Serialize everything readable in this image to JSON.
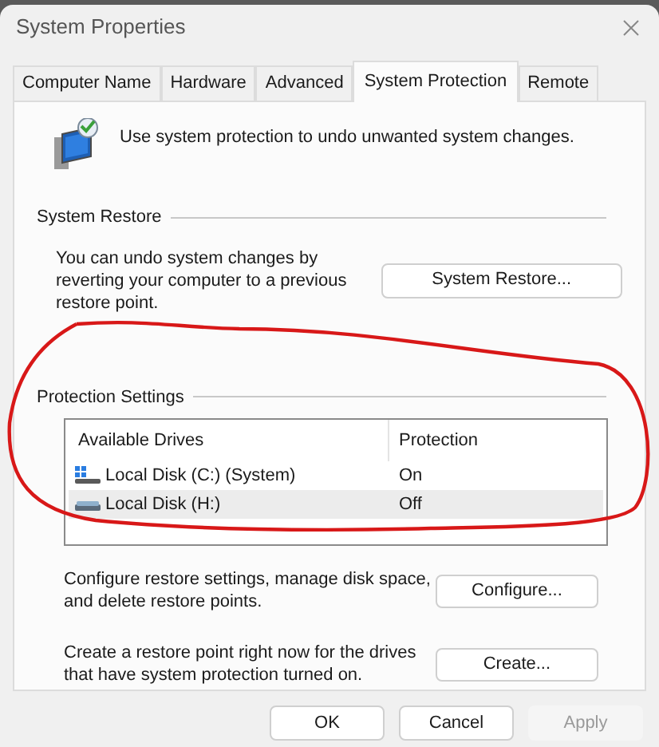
{
  "window": {
    "title": "System Properties"
  },
  "tabs": [
    {
      "label": "Computer Name",
      "selected": false
    },
    {
      "label": "Hardware",
      "selected": false
    },
    {
      "label": "Advanced",
      "selected": false
    },
    {
      "label": "System Protection",
      "selected": true
    },
    {
      "label": "Remote",
      "selected": false
    }
  ],
  "intro": "Use system protection to undo unwanted system changes.",
  "system_restore": {
    "heading": "System Restore",
    "description": "You can undo system changes by reverting your computer to a previous restore point.",
    "button": "System Restore..."
  },
  "protection_settings": {
    "heading": "Protection Settings",
    "columns": [
      "Available Drives",
      "Protection"
    ],
    "rows": [
      {
        "drive": "Local Disk (C:) (System)",
        "protection": "On",
        "kind": "system",
        "selected": false
      },
      {
        "drive": "Local Disk (H:)",
        "protection": "Off",
        "kind": "disk",
        "selected": true
      }
    ]
  },
  "actions": [
    {
      "description": "Configure restore settings, manage disk space, and delete restore points.",
      "button": "Configure..."
    },
    {
      "description": "Create a restore point right now for the drives that have system protection turned on.",
      "button": "Create..."
    }
  ],
  "buttons": [
    {
      "label": "OK",
      "disabled": false
    },
    {
      "label": "Cancel",
      "disabled": false
    },
    {
      "label": "Apply",
      "disabled": true
    }
  ]
}
